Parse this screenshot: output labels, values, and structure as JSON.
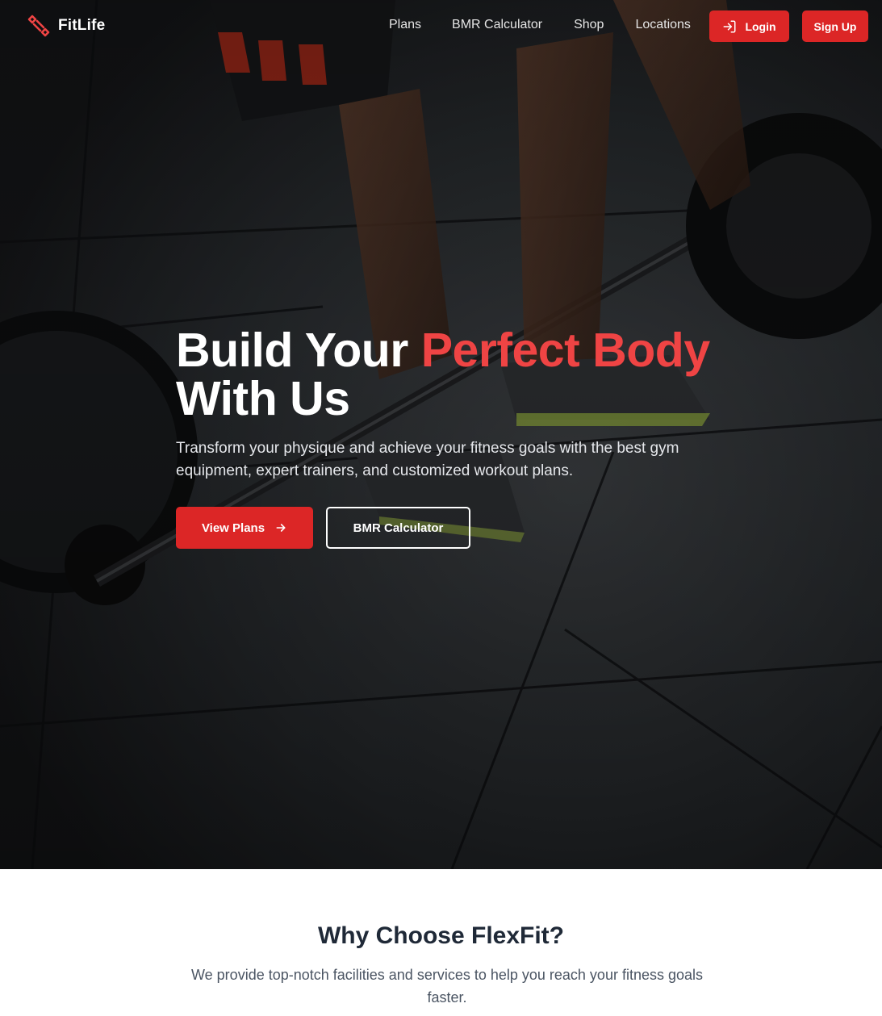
{
  "brand": {
    "name": "FitLife",
    "icon": "dumbbell-icon"
  },
  "nav": {
    "links": [
      "Plans",
      "BMR Calculator",
      "Shop",
      "Locations"
    ],
    "login_label": "Login",
    "signup_label": "Sign Up"
  },
  "hero": {
    "title_plain": "Build Your ",
    "title_accent": "Perfect Body",
    "title_line2": "With Us",
    "subtitle": "Transform your physique and achieve your fitness goals with the best gym equipment, expert trainers, and customized workout plans.",
    "primary_label": "View Plans",
    "secondary_label": "BMR Calculator"
  },
  "why": {
    "title": "Why Choose FlexFit?",
    "description": "We provide top-notch facilities and services to help you reach your fitness goals faster."
  },
  "colors": {
    "accent": "#dc2626",
    "accent_text": "#ef4444",
    "hero_bg": "#111214",
    "heading_dark": "#1f2937",
    "body_gray": "#4b5563"
  }
}
